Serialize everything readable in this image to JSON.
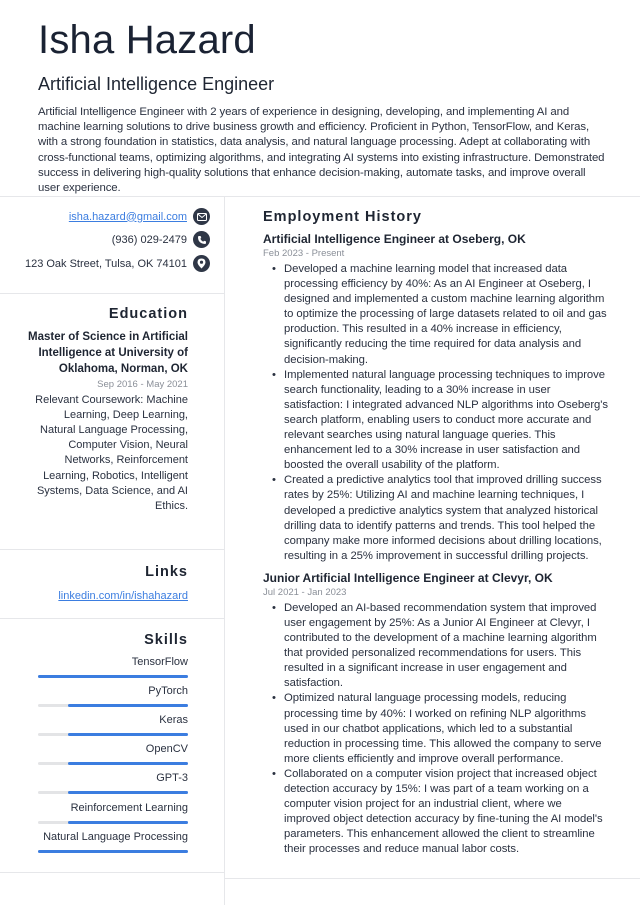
{
  "header": {
    "name": "Isha Hazard",
    "title": "Artificial Intelligence Engineer",
    "summary": "Artificial Intelligence Engineer with 2 years of experience in designing, developing, and implementing AI and machine learning solutions to drive business growth and efficiency. Proficient in Python, TensorFlow, and Keras, with a strong foundation in statistics, data analysis, and natural language processing. Adept at collaborating with cross-functional teams, optimizing algorithms, and integrating AI systems into existing infrastructure. Demonstrated success in delivering high-quality solutions that enhance decision-making, automate tasks, and improve overall user experience."
  },
  "contact": {
    "email": "isha.hazard@gmail.com",
    "phone": "(936) 029-2479",
    "address": "123 Oak Street, Tulsa, OK 74101",
    "icons": [
      "envelope-icon",
      "phone-icon",
      "map-pin-icon"
    ]
  },
  "education": {
    "heading": "Education",
    "degree": "Master of Science in Artificial Intelligence at University of Oklahoma, Norman, OK",
    "dates": "Sep 2016 - May 2021",
    "description": "Relevant Coursework: Machine Learning, Deep Learning, Natural Language Processing, Computer Vision, Neural Networks, Reinforcement Learning, Robotics, Intelligent Systems, Data Science, and AI Ethics."
  },
  "links": {
    "heading": "Links",
    "items": [
      "linkedin.com/in/ishahazard"
    ]
  },
  "skills": {
    "heading": "Skills",
    "accent_color": "#3b7de0",
    "items": [
      {
        "name": "TensorFlow",
        "level": 1.0
      },
      {
        "name": "PyTorch",
        "level": 0.8
      },
      {
        "name": "Keras",
        "level": 0.8
      },
      {
        "name": "OpenCV",
        "level": 0.8
      },
      {
        "name": "GPT-3",
        "level": 0.8
      },
      {
        "name": "Reinforcement Learning",
        "level": 0.8
      },
      {
        "name": "Natural Language Processing",
        "level": 1.0
      }
    ]
  },
  "employment": {
    "heading": "Employment History",
    "jobs": [
      {
        "title": "Artificial Intelligence Engineer at Oseberg, OK",
        "dates": "Feb 2023 - Present",
        "bullets": [
          "Developed a machine learning model that increased data processing efficiency by 40%: As an AI Engineer at Oseberg, I designed and implemented a custom machine learning algorithm to optimize the processing of large datasets related to oil and gas production. This resulted in a 40% increase in efficiency, significantly reducing the time required for data analysis and decision-making.",
          "Implemented natural language processing techniques to improve search functionality, leading to a 30% increase in user satisfaction: I integrated advanced NLP algorithms into Oseberg's search platform, enabling users to conduct more accurate and relevant searches using natural language queries. This enhancement led to a 30% increase in user satisfaction and boosted the overall usability of the platform.",
          "Created a predictive analytics tool that improved drilling success rates by 25%: Utilizing AI and machine learning techniques, I developed a predictive analytics system that analyzed historical drilling data to identify patterns and trends. This tool helped the company make more informed decisions about drilling locations, resulting in a 25% improvement in successful drilling projects."
        ]
      },
      {
        "title": "Junior Artificial Intelligence Engineer at Clevyr, OK",
        "dates": "Jul 2021 - Jan 2023",
        "bullets": [
          "Developed an AI-based recommendation system that improved user engagement by 25%: As a Junior AI Engineer at Clevyr, I contributed to the development of a machine learning algorithm that provided personalized recommendations for users. This resulted in a significant increase in user engagement and satisfaction.",
          "Optimized natural language processing models, reducing processing time by 40%: I worked on refining NLP algorithms used in our chatbot applications, which led to a substantial reduction in processing time. This allowed the company to serve more clients efficiently and improve overall performance.",
          "Collaborated on a computer vision project that increased object detection accuracy by 15%: I was part of a team working on a computer vision project for an industrial client, where we improved object detection accuracy by fine-tuning the AI model's parameters. This enhancement allowed the client to streamline their processes and reduce manual labor costs."
        ]
      }
    ]
  }
}
